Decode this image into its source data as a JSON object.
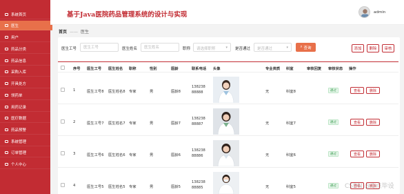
{
  "sidebar": {
    "items": [
      {
        "label": "系统首页",
        "active": false
      },
      {
        "label": "医生",
        "active": true
      },
      {
        "label": "用户",
        "active": false
      },
      {
        "label": "药品分类",
        "active": false
      },
      {
        "label": "药品信息",
        "active": false
      },
      {
        "label": "采购入库",
        "active": false
      },
      {
        "label": "开具处方",
        "active": false
      },
      {
        "label": "领药单",
        "active": false
      },
      {
        "label": "用药记录",
        "active": false
      },
      {
        "label": "医疗数据",
        "active": false
      },
      {
        "label": "药品预警",
        "active": false
      },
      {
        "label": "系统管理",
        "active": false
      },
      {
        "label": "订单管理",
        "active": false
      },
      {
        "label": "个人中心",
        "active": false
      }
    ]
  },
  "header": {
    "title": "基于Java医院药品管理系统的设计与实现",
    "username": "admin"
  },
  "breadcrumb": {
    "home": "首页",
    "separator": "——",
    "current": "医生"
  },
  "search": {
    "doctor_id_label": "医生工号",
    "doctor_id_placeholder": "医生工号",
    "doctor_name_label": "医生姓名",
    "doctor_name_placeholder": "医生姓名",
    "title_label": "职称",
    "title_placeholder": "请选择职称",
    "review_label": "是否通过",
    "review_placeholder": "是否通过",
    "search_button": "查询"
  },
  "actions": {
    "add": "添加",
    "delete": "删除",
    "review": "审核"
  },
  "table": {
    "headers": [
      "序号",
      "医生工号",
      "医生姓名",
      "职称",
      "性别",
      "医龄",
      "联系电话",
      "头像",
      "专业资质",
      "科室",
      "审核回复",
      "审核状态",
      "操作"
    ],
    "rows": [
      {
        "index": "1",
        "doctor_id": "医生工号8",
        "doctor_name": "医生姓名8",
        "title": "专家",
        "gender": "男",
        "age": "医龄8",
        "phone": "13823888888",
        "qualification": "无",
        "department": "科室8",
        "reply": "",
        "status": "通过",
        "view": "查看",
        "delete": "删除"
      },
      {
        "index": "2",
        "doctor_id": "医生工号7",
        "doctor_name": "医生姓名7",
        "title": "专家",
        "gender": "男",
        "age": "医龄7",
        "phone": "13823888887",
        "qualification": "无",
        "department": "科室7",
        "reply": "",
        "status": "通过",
        "view": "查看",
        "delete": "删除"
      },
      {
        "index": "3",
        "doctor_id": "医生工号6",
        "doctor_name": "医生姓名6",
        "title": "专家",
        "gender": "男",
        "age": "医龄6",
        "phone": "13823888886",
        "qualification": "无",
        "department": "科室6",
        "reply": "",
        "status": "通过",
        "view": "查看",
        "delete": "删除"
      },
      {
        "index": "4",
        "doctor_id": "医生工号5",
        "doctor_name": "医生姓名5",
        "title": "专家",
        "gender": "男",
        "age": "医龄5",
        "phone": "13823888885",
        "qualification": "无",
        "department": "科室5",
        "reply": "",
        "status": "通过",
        "view": "查看",
        "delete": "删除"
      }
    ]
  },
  "watermark": "CSDN @Q点毕设",
  "colors": {
    "primary": "#c22c33",
    "accent": "#e8704a",
    "success": "#3a9b4f"
  }
}
